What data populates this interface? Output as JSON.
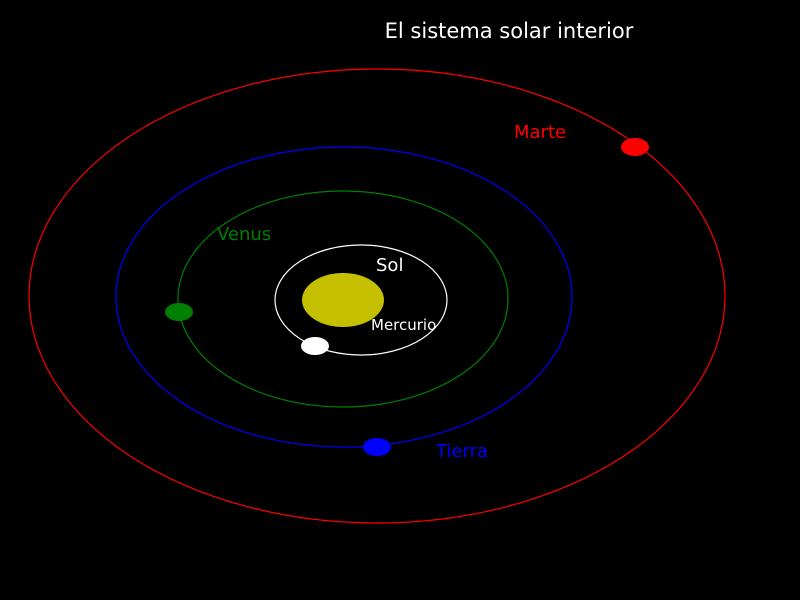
{
  "title": "El sistema solar interior",
  "colors": {
    "background": "#000000",
    "sun": "#c4c000",
    "mercury": "#ffffff",
    "venus": "#008000",
    "earth": "#0000ff",
    "mars": "#ff0000",
    "title": "#ffffff"
  },
  "bodies": {
    "sun": {
      "label": "Sol"
    },
    "mercury": {
      "label": "Mercurio"
    },
    "venus": {
      "label": "Venus"
    },
    "earth": {
      "label": "Tierra"
    },
    "mars": {
      "label": "Marte"
    }
  }
}
